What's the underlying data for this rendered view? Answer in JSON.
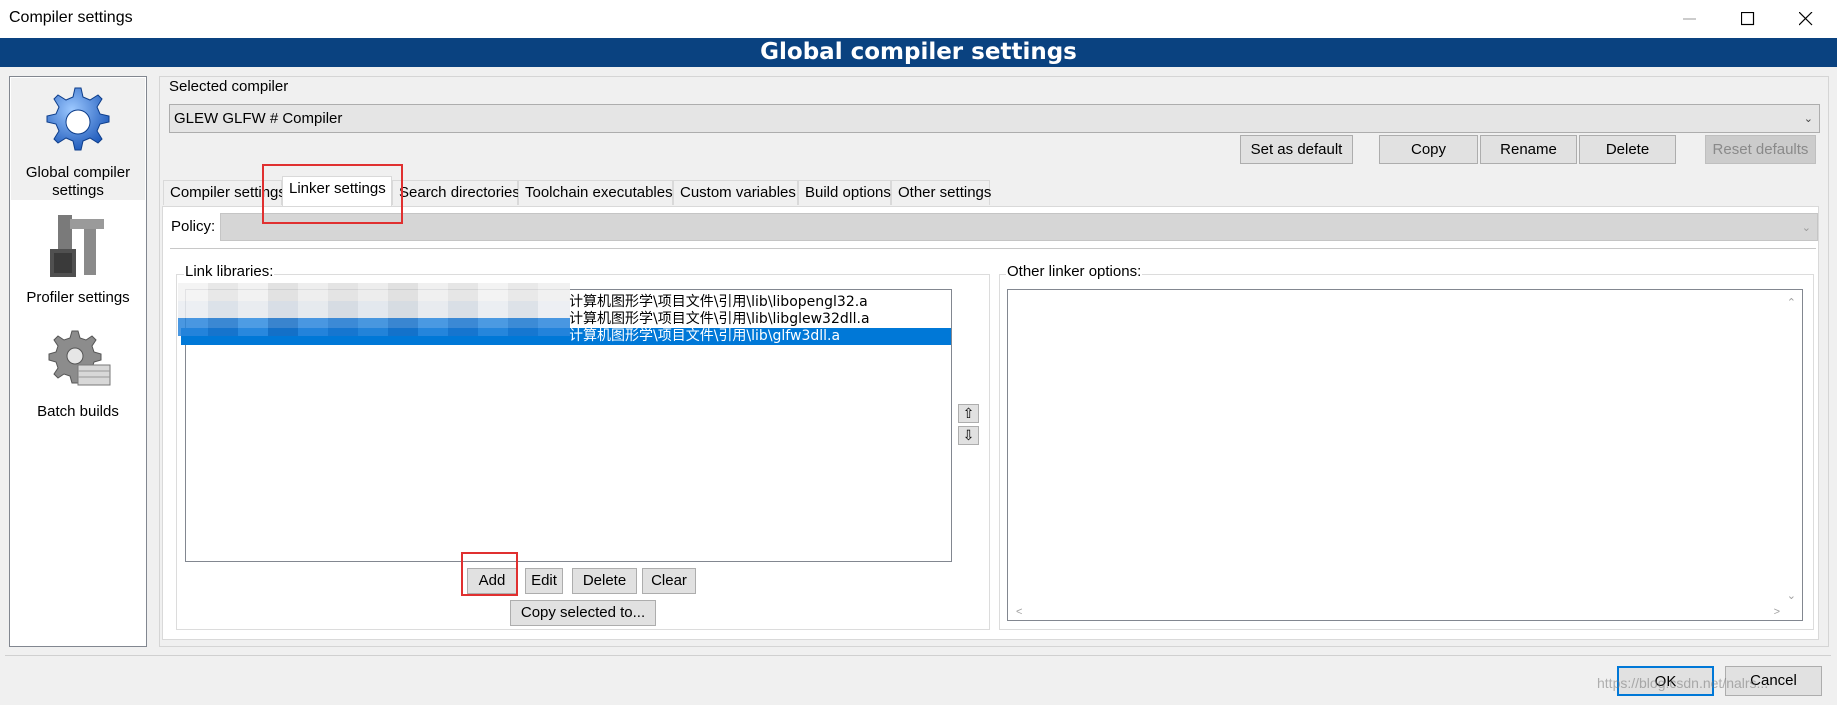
{
  "window": {
    "title": "Compiler settings"
  },
  "banner": {
    "title": "Global compiler settings"
  },
  "nav": {
    "items": [
      {
        "label": "Global compiler settings",
        "icon": "gear-icon"
      },
      {
        "label": "Profiler settings",
        "icon": "caliper-icon"
      },
      {
        "label": "Batch builds",
        "icon": "gear-stack-icon"
      }
    ]
  },
  "compiler": {
    "label": "Selected compiler",
    "selected": "GLEW GLFW # Compiler",
    "buttons": {
      "set_default": "Set as default",
      "copy": "Copy",
      "rename": "Rename",
      "delete": "Delete",
      "reset": "Reset defaults"
    }
  },
  "tabs": [
    "Compiler settings",
    "Linker settings",
    "Search directories",
    "Toolchain executables",
    "Custom variables",
    "Build options",
    "Other settings"
  ],
  "policy": {
    "label": "Policy:",
    "value": ""
  },
  "link_libraries": {
    "label": "Link libraries:",
    "items": [
      {
        "text": "计算机图形学\\项目文件\\引用\\lib\\libopengl32.a",
        "selected": false
      },
      {
        "text": "计算机图形学\\项目文件\\引用\\lib\\libglew32dll.a",
        "selected": false
      },
      {
        "text": "计算机图形学\\项目文件\\引用\\lib\\glfw3dll.a",
        "selected": true
      }
    ],
    "buttons": {
      "add": "Add",
      "edit": "Edit",
      "delete": "Delete",
      "clear": "Clear",
      "copy_to": "Copy selected to..."
    },
    "move_up": "⇧",
    "move_down": "⇩"
  },
  "other_linker": {
    "label": "Other linker options:",
    "value": ""
  },
  "footer": {
    "ok": "OK",
    "cancel": "Cancel",
    "watermark": "https://blog.csdn.net/nalrs..."
  },
  "colors": {
    "banner": "#0a4280",
    "selection": "#0078d7",
    "highlight": "#e03030"
  }
}
